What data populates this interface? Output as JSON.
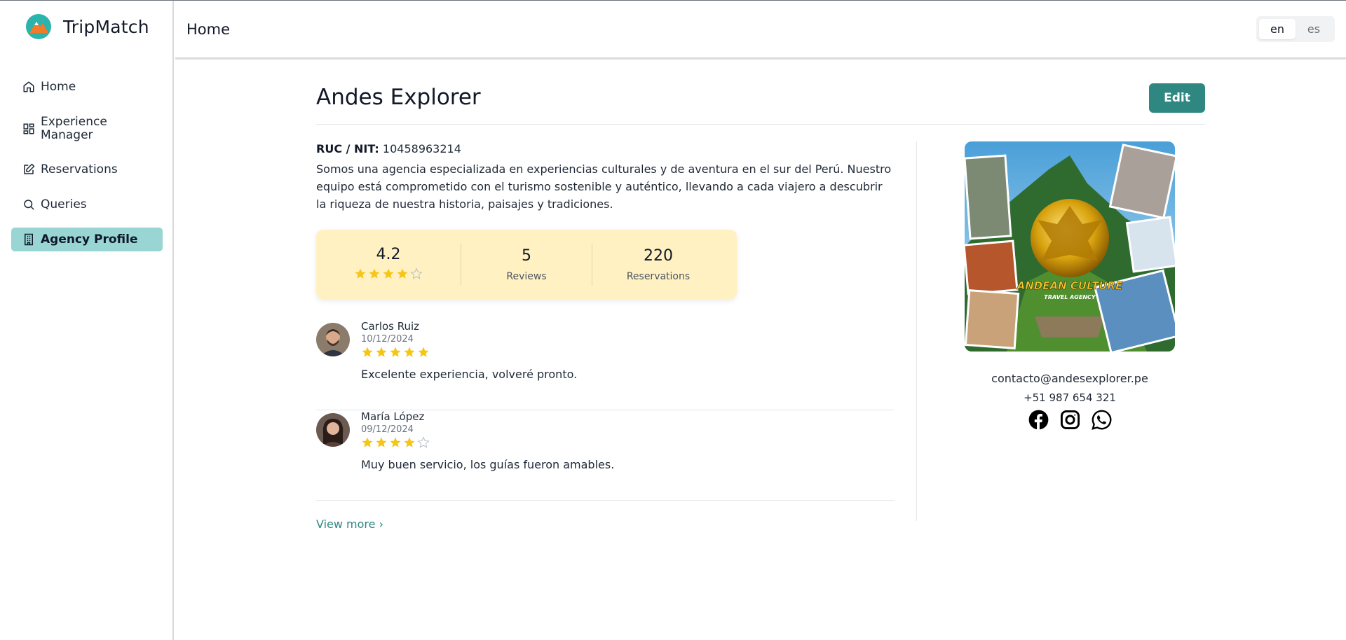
{
  "app": {
    "name": "TripMatch"
  },
  "sidebar": {
    "items": [
      {
        "label": "Home",
        "icon": "home-icon",
        "active": false
      },
      {
        "label": "Experience Manager",
        "icon": "grid-icon",
        "active": false
      },
      {
        "label": "Reservations",
        "icon": "edit-icon",
        "active": false
      },
      {
        "label": "Queries",
        "icon": "search-icon",
        "active": false
      },
      {
        "label": "Agency Profile",
        "icon": "building-icon",
        "active": true
      }
    ]
  },
  "header": {
    "title": "Home",
    "languages": [
      {
        "label": "en",
        "active": true
      },
      {
        "label": "es",
        "active": false
      }
    ]
  },
  "profile": {
    "name": "Andes Explorer",
    "edit_label": "Edit",
    "ruc_label": "RUC / NIT:",
    "ruc_value": "10458963214",
    "description": "Somos una agencia especializada en experiencias culturales y de aventura en el sur del Perú. Nuestro equipo está comprometido con el turismo sostenible y auténtico, llevando a cada viajero a descubrir la riqueza de nuestra historia, paisajes y tradiciones.",
    "image_caption": "ANDEAN CULTURE",
    "image_subcaption": "TRAVEL AGENCY"
  },
  "stats": {
    "rating": "4.2",
    "rating_stars": 4,
    "reviews_value": "5",
    "reviews_label": "Reviews",
    "reservations_value": "220",
    "reservations_label": "Reservations"
  },
  "reviews": [
    {
      "name": "Carlos Ruiz",
      "date": "10/12/2024",
      "stars": 5,
      "text": "Excelente experiencia, volveré pronto."
    },
    {
      "name": "María López",
      "date": "09/12/2024",
      "stars": 4,
      "text": "Muy buen servicio, los guías fueron amables."
    }
  ],
  "view_more": "View more ›",
  "contact": {
    "email": "contacto@andesexplorer.pe",
    "phone": "+51 987 654 321",
    "socials": [
      "facebook-icon",
      "instagram-icon",
      "whatsapp-icon"
    ]
  },
  "colors": {
    "accent": "#2e8781",
    "sidebar_active": "#99d5d2",
    "stats_bg": "#fff1c2",
    "star": "#f5c518"
  }
}
